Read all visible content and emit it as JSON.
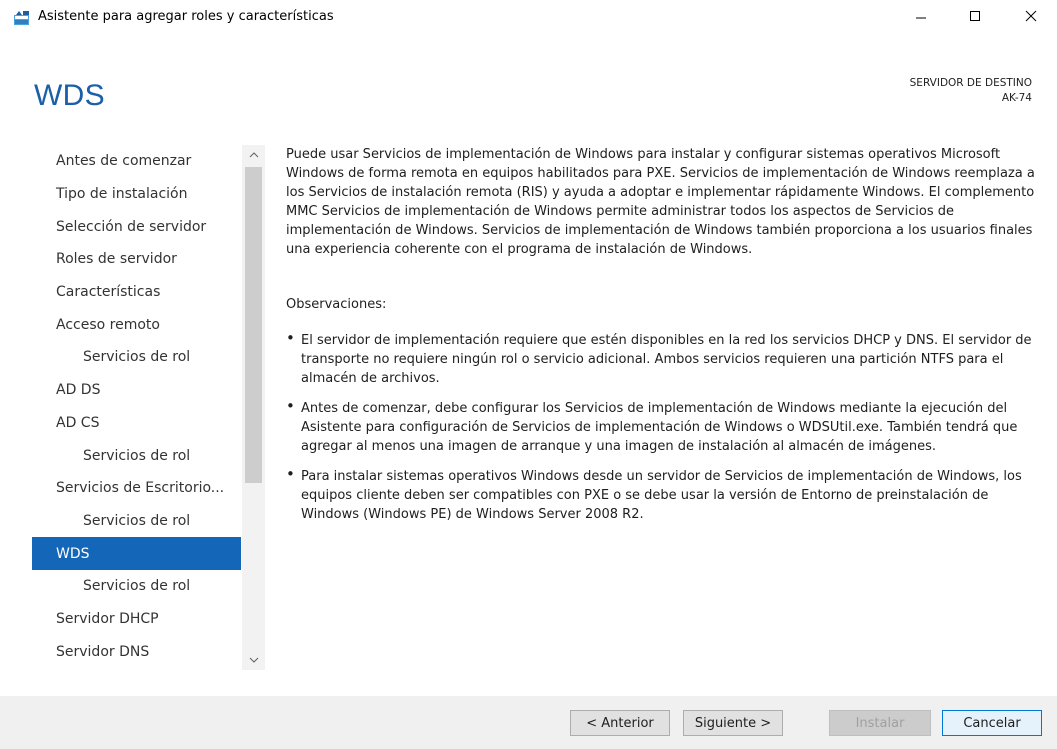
{
  "window": {
    "title": "Asistente para agregar roles y características",
    "minimize_glyph": "—",
    "maximize_glyph": "☐",
    "close_glyph": "✕",
    "icon": "server-wizard-icon"
  },
  "header": {
    "page_title": "WDS",
    "destination_label": "SERVIDOR DE DESTINO",
    "destination_server": "AK-74"
  },
  "nav": {
    "items": [
      {
        "label": "Antes de comenzar",
        "sub": false,
        "active": false
      },
      {
        "label": "Tipo de instalación",
        "sub": false,
        "active": false
      },
      {
        "label": "Selección de servidor",
        "sub": false,
        "active": false
      },
      {
        "label": "Roles de servidor",
        "sub": false,
        "active": false
      },
      {
        "label": "Características",
        "sub": false,
        "active": false
      },
      {
        "label": "Acceso remoto",
        "sub": false,
        "active": false
      },
      {
        "label": "Servicios de rol",
        "sub": true,
        "active": false
      },
      {
        "label": "AD DS",
        "sub": false,
        "active": false
      },
      {
        "label": "AD CS",
        "sub": false,
        "active": false
      },
      {
        "label": "Servicios de rol",
        "sub": true,
        "active": false
      },
      {
        "label": "Servicios de Escritorio...",
        "sub": false,
        "active": false
      },
      {
        "label": "Servicios de rol",
        "sub": true,
        "active": false
      },
      {
        "label": "WDS",
        "sub": false,
        "active": true
      },
      {
        "label": "Servicios de rol",
        "sub": true,
        "active": false
      },
      {
        "label": "Servidor DHCP",
        "sub": false,
        "active": false
      },
      {
        "label": "Servidor DNS",
        "sub": false,
        "active": false
      }
    ],
    "active_color": "#1467b8"
  },
  "content": {
    "description": "Puede usar Servicios de implementación de Windows para instalar y configurar sistemas operativos Microsoft Windows de forma remota en equipos habilitados para PXE. Servicios de implementación de Windows reemplaza a los Servicios de instalación remota (RIS) y ayuda a adoptar e implementar rápidamente Windows. El complemento MMC Servicios de implementación de Windows permite administrar todos los aspectos de Servicios de implementación de Windows. Servicios de implementación de Windows también proporciona a los usuarios finales una experiencia coherente con el programa de instalación de Windows.",
    "observations_title": "Observaciones:",
    "observations": [
      "El servidor de implementación requiere que estén disponibles en la red los servicios DHCP y DNS. El servidor de transporte no requiere ningún rol o servicio adicional. Ambos servicios requieren una partición NTFS para el almacén de archivos.",
      "Antes de comenzar, debe configurar los Servicios de implementación de Windows mediante la ejecución del Asistente para configuración de Servicios de implementación de Windows o WDSUtil.exe. También tendrá que agregar al menos una imagen de arranque y una imagen de instalación al almacén de imágenes.",
      "Para instalar sistemas operativos Windows desde un servidor de Servicios de implementación de Windows, los equipos cliente deben ser compatibles con PXE o se debe usar la versión de Entorno de preinstalación de Windows (Windows PE) de Windows Server 2008 R2."
    ]
  },
  "footer": {
    "back_label": "< Anterior",
    "next_label": "Siguiente >",
    "install_label": "Instalar",
    "cancel_label": "Cancelar"
  },
  "colors": {
    "title_blue": "#1b5fa8",
    "footer_bg": "#f0f0f0"
  }
}
